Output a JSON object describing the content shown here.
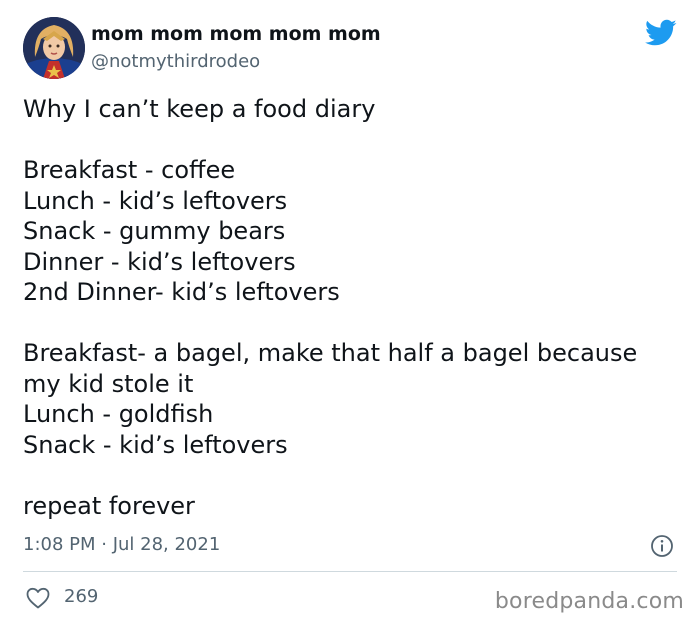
{
  "author": {
    "name": "mom mom mom mom mom",
    "handle": "@notmythirdrodeo"
  },
  "icons": {
    "avatar": "avatar-image",
    "brand": "twitter-bird-icon",
    "info": "info-icon",
    "like": "heart-icon"
  },
  "tweet": {
    "lines": [
      "Why I can’t keep a food diary",
      "",
      "Breakfast - coffee",
      "Lunch - kid’s leftovers",
      "Snack - gummy bears",
      "Dinner - kid’s leftovers",
      "2nd Dinner- kid’s leftovers",
      "",
      "Breakfast- a bagel, make that half a bagel because",
      "my kid stole it",
      "Lunch - goldfish",
      "Snack - kid’s leftovers",
      "",
      "repeat forever"
    ]
  },
  "meta": {
    "timestamp": "1:08 PM · Jul 28, 2021"
  },
  "engagement": {
    "likes": "269"
  },
  "watermark": "boredpanda.com",
  "colors": {
    "text": "#0f1419",
    "secondary": "#536471",
    "twitter_blue": "#1d9bf0",
    "divider": "#cfd9de"
  }
}
